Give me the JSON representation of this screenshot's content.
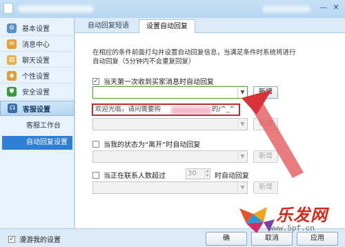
{
  "sidebar": {
    "items": [
      {
        "label": "基本设置",
        "icon": "gear-icon",
        "color": "#5b8fc4"
      },
      {
        "label": "消息中心",
        "icon": "envelope-icon",
        "color": "#e8a034"
      },
      {
        "label": "聊天设置",
        "icon": "chat-icon",
        "color": "#e4b44a"
      },
      {
        "label": "个性设置",
        "icon": "palette-icon",
        "color": "#d9a23d"
      },
      {
        "label": "安全设置",
        "icon": "shield-icon",
        "color": "#3b9a3f"
      },
      {
        "label": "客服设置",
        "icon": "headset-icon",
        "color": "#3a6ea8"
      }
    ],
    "sub_items": [
      {
        "label": "客服工作台"
      },
      {
        "label": "自动回复设置"
      }
    ]
  },
  "tabs": [
    {
      "label": "自动回复短语"
    },
    {
      "label": "设置自动回复"
    }
  ],
  "content": {
    "description": "在相应的条件前面打勾并设置自动回复信息，当满足条件时系统将进行自动回复（5分钟内不会重复回复）",
    "rule1": {
      "label": "当天第一次收到买家消息时自动回复",
      "checked": "✓",
      "add": "新增"
    },
    "preview_text": "欢迎光临，请问需要购",
    "preview_tail": "的/^_^",
    "rule2": {
      "add": "新增"
    },
    "rule3": {
      "label": "当我的状态为“离开”时自动回复",
      "add": "新增"
    },
    "rule4": {
      "label_prefix": "当正在联系人数超过",
      "count": "30",
      "label_suffix": "时自动回复",
      "add": "新增"
    }
  },
  "footer": {
    "roam_label": "漫游我的设置",
    "roam_checked": "✓",
    "ok": "确",
    "cancel": "取消",
    "apply": "应用"
  },
  "watermark": {
    "text": "乐发网",
    "url": "www.5pf.cn"
  },
  "colors": {
    "accent": "#2f7fd6",
    "highlight_red": "#c2292b",
    "focus_green": "#5aa840"
  }
}
